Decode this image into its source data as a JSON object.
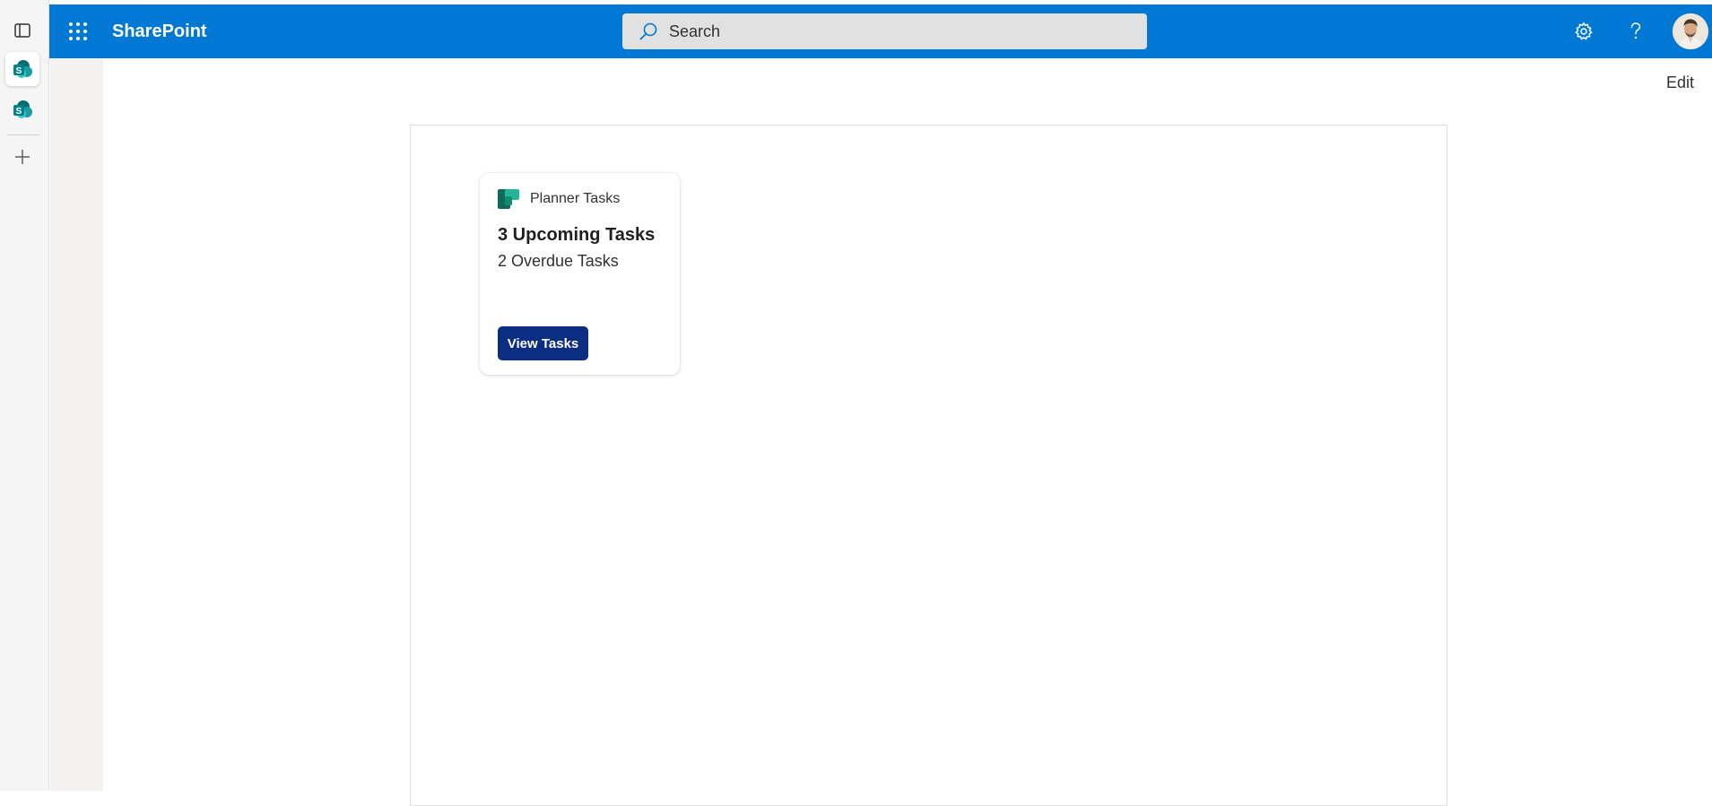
{
  "suitebar": {
    "brand": "SharePoint",
    "search_placeholder": "Search",
    "accent_color": "#0078d4",
    "icons": [
      "app-launcher-icon",
      "search-icon",
      "settings-gear-icon",
      "help-question-icon"
    ]
  },
  "rail": {
    "icons": [
      "app-panel-icon",
      "sharepoint-site-icon",
      "sharepoint-site-icon",
      "add-icon"
    ]
  },
  "page": {
    "edit_label": "Edit"
  },
  "card": {
    "app_name": "Planner Tasks",
    "title": "3 Upcoming Tasks",
    "subtitle": "2 Overdue Tasks",
    "button_label": "View Tasks",
    "button_color": "#0b2e82",
    "icon": "planner-icon"
  }
}
